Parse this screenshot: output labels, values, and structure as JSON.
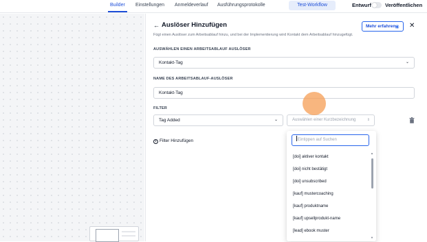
{
  "header": {
    "tabs": [
      {
        "label": "Builder",
        "active": true
      },
      {
        "label": "Einstellungen"
      },
      {
        "label": "Anmeldeverlauf"
      },
      {
        "label": "Ausführungsprotokolle"
      }
    ],
    "test_button": "Test-Workflow",
    "draft_label": "Entwurf",
    "publish_label": "Veröffentlichen",
    "publish_toggle_on": false
  },
  "panel": {
    "title": "Auslöser Hinzufügen",
    "subtitle": "Fügt einen Auslöser zum Arbeitsablauf hinzu, und bei der Implementierung wird Kontakt dem Arbeitsablauf hinzugefügt.",
    "learn_more": "Mehr erfahren",
    "trigger_label": "AUSWÄHLEN EINEN ARBEITSABLAUF AUSLÖSER",
    "trigger_value": "Kontakt-Tag",
    "name_label": "NAME DES ARBEITSABLAUF-AUSLÖSER",
    "name_value": "Kontakt-Tag",
    "filter_label": "FILTER",
    "filter_field": "Tag Added",
    "filter_value_placeholder": "Auswählen einer Kurzbezeichnung",
    "add_filter": "Filter Hinzufügen"
  },
  "dropdown": {
    "search_placeholder": "Eintippen auf Suchen",
    "options": [
      "[doi] aktiver kontakt",
      "[doi] nicht bestätigt",
      "[doi] unsubscribed",
      "[kauf] mustercoaching",
      "[kauf] produktname",
      "[kauf] upsellprodukt-name",
      "[lead] ebook muster"
    ]
  },
  "colors": {
    "accent": "#1d4ed8",
    "canvas": "#f4f5f7",
    "cursor_highlight": "#f59e54"
  }
}
